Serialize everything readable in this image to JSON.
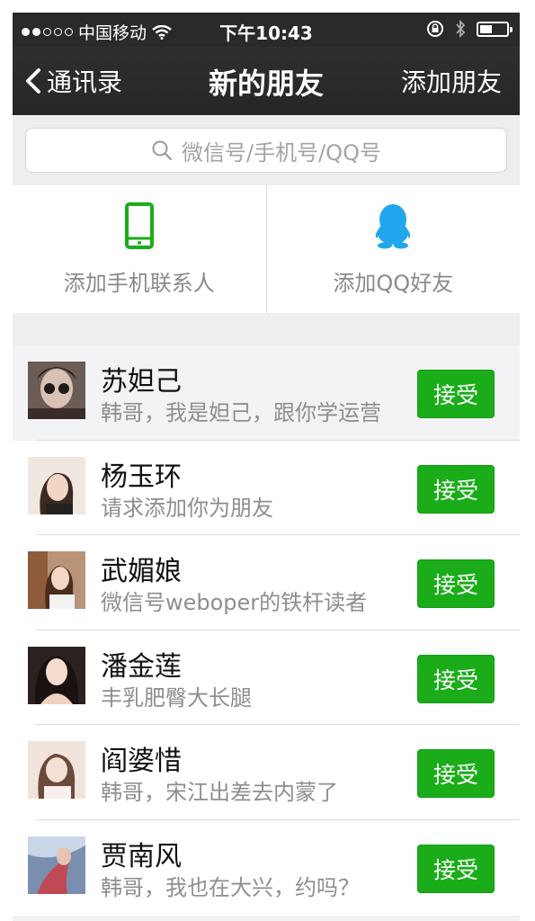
{
  "status_bar": {
    "carrier": "中国移动",
    "time": "下午10:43"
  },
  "nav": {
    "back_label": "通讯录",
    "title": "新的朋友",
    "right_label": "添加朋友"
  },
  "search": {
    "placeholder": "微信号/手机号/QQ号"
  },
  "quick_add": [
    {
      "label": "添加手机联系人",
      "icon": "phone-icon"
    },
    {
      "label": "添加QQ好友",
      "icon": "qq-penguin-icon"
    }
  ],
  "requests": [
    {
      "name": "苏妲己",
      "message": "韩哥，我是妲己，跟你学运营",
      "action": "接受"
    },
    {
      "name": "杨玉环",
      "message": "请求添加你为朋友",
      "action": "接受"
    },
    {
      "name": "武媚娘",
      "message": "微信号weboper的铁杆读者",
      "action": "接受"
    },
    {
      "name": "潘金莲",
      "message": "丰乳肥臀大长腿",
      "action": "接受"
    },
    {
      "name": "阎婆惜",
      "message": "韩哥，宋江出差去内蒙了",
      "action": "接受"
    },
    {
      "name": "贾南风",
      "message": "韩哥，我也在大兴，约吗？",
      "action": "接受"
    }
  ],
  "colors": {
    "accept_green": "#1aad19",
    "navbar": "#2a2a2c",
    "phone_icon": "#1aad19",
    "qq_icon": "#21a6ee"
  }
}
